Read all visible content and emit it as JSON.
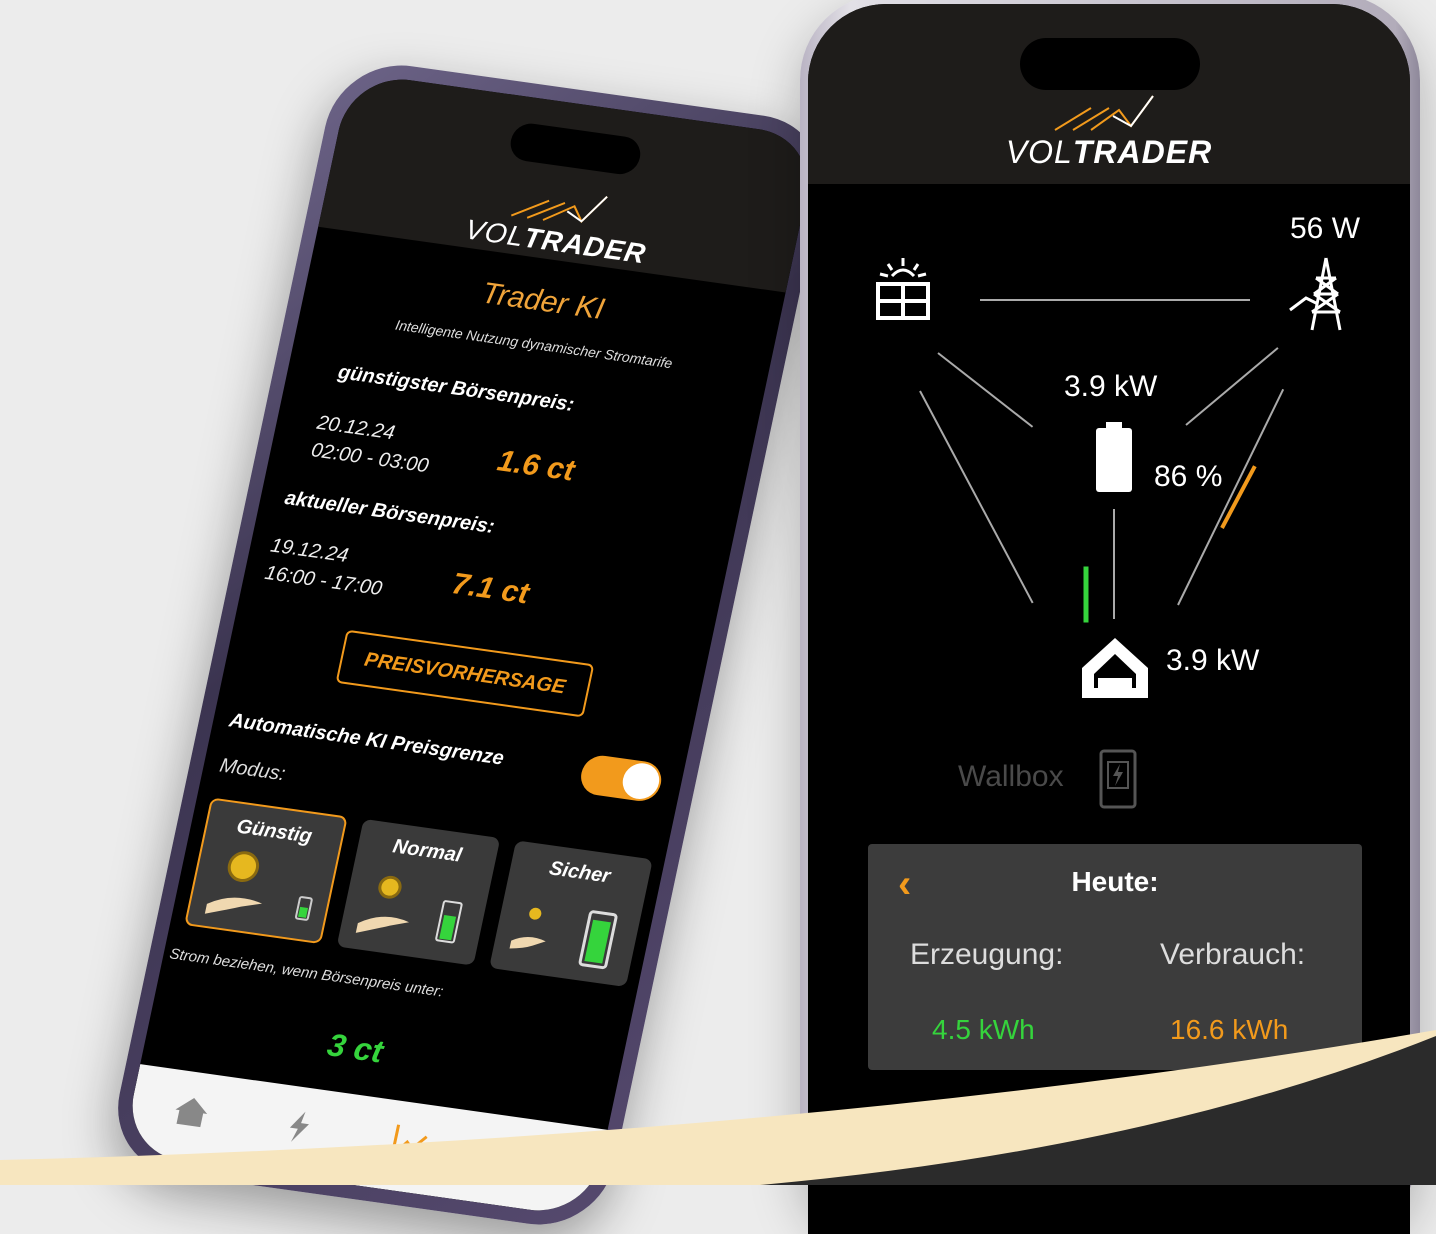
{
  "colors": {
    "accent": "#f29a1c",
    "green": "#35d43c",
    "dark": "#1e1c1a"
  },
  "left_phone": {
    "logo": {
      "prefix": "VOL",
      "bold": "TRADER"
    },
    "title": "Trader KI",
    "subtitle": "Intelligente Nutzung dynamischer Stromtarife",
    "cheapest": {
      "label": "günstigster Börsenpreis:",
      "date": "20.12.24",
      "time": "02:00 - 03:00",
      "price": "1.6 ct"
    },
    "current": {
      "label": "aktueller Börsenpreis:",
      "date": "19.12.24",
      "time": "16:00 - 17:00",
      "price": "7.1 ct"
    },
    "forecast_button": "PREISVORHERSAGE",
    "auto_limit": {
      "label": "Automatische KI Preisgrenze",
      "enabled": true
    },
    "modus_label": "Modus:",
    "modes": [
      {
        "label": "Günstig",
        "active": true
      },
      {
        "label": "Normal",
        "active": false
      },
      {
        "label": "Sicher",
        "active": false
      }
    ],
    "threshold_text": "Strom beziehen, wenn Börsenpreis unter:",
    "threshold_value": "3 ct",
    "nav": [
      "home-icon",
      "bolt-icon",
      "chart-icon",
      "user-icon"
    ]
  },
  "right_phone": {
    "logo": {
      "prefix": "VOL",
      "bold": "TRADER"
    },
    "grid_power": "56 W",
    "battery_power": "3.9 kW",
    "battery_soc": "86 %",
    "house_power": "3.9 kW",
    "wallbox_label": "Wallbox",
    "today": {
      "title": "Heute:",
      "generation_label": "Erzeugung:",
      "consumption_label": "Verbrauch:",
      "generation_value": "4.5 kWh",
      "consumption_value": "16.6 kWh"
    }
  }
}
